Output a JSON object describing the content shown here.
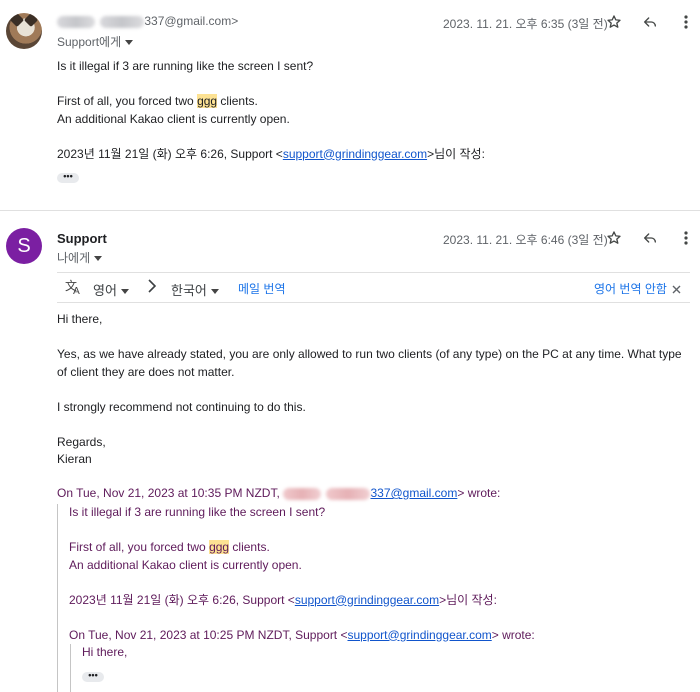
{
  "message1": {
    "sender_email_suffix": "337@gmail.com",
    "to_label": "Support에게",
    "date": "2023. 11. 21. 오후 6:35 (3일 전)",
    "body_lines": [
      "Is it illegal if 3 are running like the screen I sent?",
      "First of all, you forced two ",
      "ggg",
      " clients.",
      "An additional Kakao client is currently open."
    ],
    "quote_header_prefix": "2023년 11월 21일 (화) 오후 6:26, Support <",
    "quote_header_link": "support@grindinggear.com",
    "quote_header_suffix": ">님이 작성:",
    "more_label": "•••"
  },
  "message2": {
    "avatar_letter": "S",
    "sender_name": "Support",
    "to_label": "나에게",
    "date": "2023. 11. 21. 오후 6:46 (3일 전)",
    "translate_bar": {
      "source_lang": "영어",
      "target_lang": "한국어",
      "translate_link": "메일 번역",
      "dont_translate": "영어 번역 안함"
    },
    "body": {
      "greeting": "Hi there,",
      "para1_line1": "Yes, as we have already stated, you are only allowed to run two clients (of any type) on the PC at any time. What type",
      "para1_line2": "of client they are does not matter.",
      "para2": "I strongly recommend not continuing to do this.",
      "sign1": "Regards,",
      "sign2": "Kieran"
    },
    "quote_intro_prefix": "On Tue, Nov 21, 2023 at 10:35 PM NZDT, ",
    "quote_intro_email_suffix": "337@gmail.com",
    "quote_intro_suffix": "> wrote:",
    "quoted": {
      "line1": "Is it illegal if 3 are running like the screen I sent?",
      "line2_a": "First of all, you forced two ",
      "line2_hl": "ggg",
      "line2_b": " clients.",
      "line3": "An additional Kakao client is currently open.",
      "hdr_prefix": "2023년 11월 21일 (화) 오후 6:26, Support <",
      "hdr_link": "support@grindinggear.com",
      "hdr_suffix": ">님이 작성:",
      "nested_intro_prefix": "On Tue, Nov 21, 2023 at 10:25 PM NZDT, Support <",
      "nested_intro_link": "support@grindinggear.com",
      "nested_intro_suffix": "> wrote:",
      "nested_greeting": "Hi there,"
    },
    "more_label": "•••"
  },
  "icons": {
    "star": "star-icon",
    "reply": "reply-icon",
    "more": "more-vert-icon",
    "translate": "translate-icon",
    "arrow": "chevron-right-icon",
    "close": "close-icon"
  },
  "colors": {
    "avatar_support": "#7b1fa2",
    "link": "#1155cc",
    "quote_text": "#5e1a5a",
    "highlight": "#fde293"
  }
}
